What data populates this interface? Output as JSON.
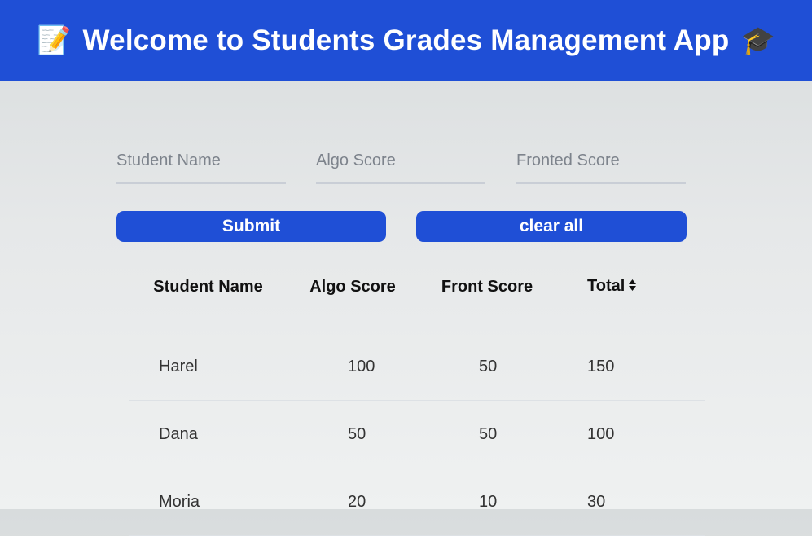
{
  "header": {
    "title": "Welcome to Students Grades Management App",
    "left_icon": "📝",
    "right_icon": "🎓"
  },
  "form": {
    "student_name_placeholder": "Student Name",
    "algo_score_placeholder": "Algo Score",
    "frontend_score_placeholder": "Fronted Score",
    "submit_label": "Submit",
    "clear_label": "clear all"
  },
  "table": {
    "columns": [
      "Student Name",
      "Algo Score",
      "Front Score",
      "Total"
    ],
    "rows": [
      {
        "name": "Harel",
        "algo": "100",
        "front": "50",
        "total": "150"
      },
      {
        "name": "Dana",
        "algo": "50",
        "front": "50",
        "total": "100"
      },
      {
        "name": "Moria",
        "algo": "20",
        "front": "10",
        "total": "30"
      }
    ]
  },
  "colors": {
    "accent": "#1f4fd6"
  },
  "icons": {
    "sort": "sort-icon"
  }
}
